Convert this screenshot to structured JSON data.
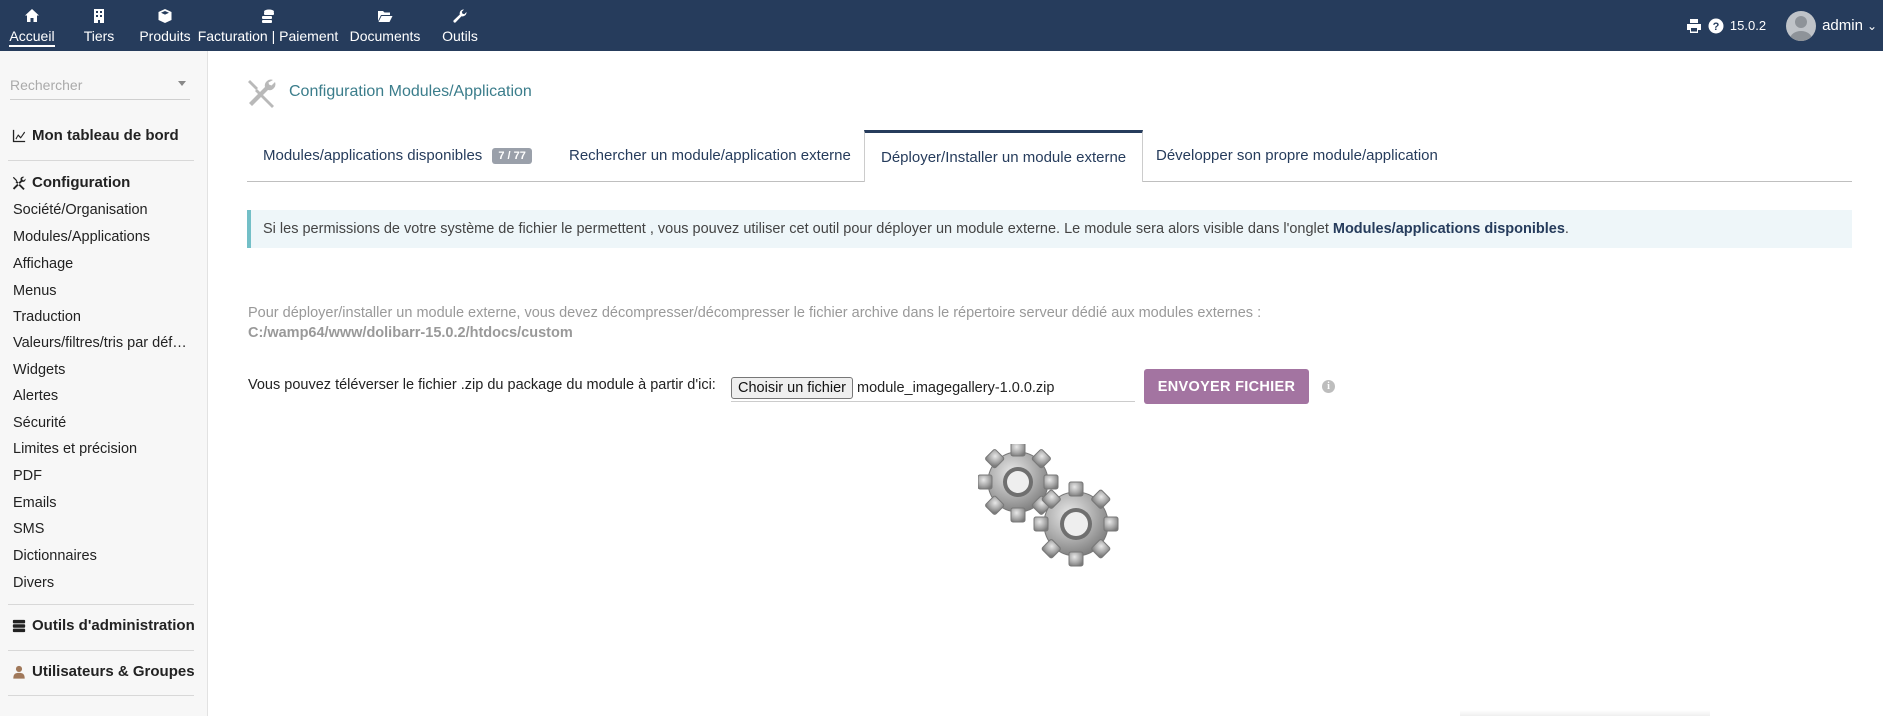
{
  "topmenu": {
    "items": [
      {
        "label": "Accueil",
        "icon": "home-icon"
      },
      {
        "label": "Tiers",
        "icon": "building-icon"
      },
      {
        "label": "Produits",
        "icon": "cube-icon"
      },
      {
        "label": "Facturation | Paiement",
        "icon": "coins-icon"
      },
      {
        "label": "Documents",
        "icon": "folder-open-icon"
      },
      {
        "label": "Outils",
        "icon": "wrench-icon"
      }
    ],
    "version": "15.0.2",
    "username": "admin"
  },
  "sidebar": {
    "search_placeholder": "Rechercher",
    "dashboard_label": "Mon tableau de bord",
    "config_label": "Configuration",
    "config_items": [
      "Société/Organisation",
      "Modules/Applications",
      "Affichage",
      "Menus",
      "Traduction",
      "Valeurs/filtres/tris par déf…",
      "Widgets",
      "Alertes",
      "Sécurité",
      "Limites et précision",
      "PDF",
      "Emails",
      "SMS",
      "Dictionnaires",
      "Divers"
    ],
    "admin_tools_label": "Outils d'administration",
    "users_label": "Utilisateurs & Groupes"
  },
  "main": {
    "title": "Configuration Modules/Application",
    "tabs": [
      {
        "label": "Modules/applications disponibles",
        "badge": "7 / 77"
      },
      {
        "label": "Rechercher un module/application externe"
      },
      {
        "label": "Déployer/Installer un module externe"
      },
      {
        "label": "Développer son propre module/application"
      }
    ],
    "active_tab": "Déployer/Installer un module externe",
    "info_text": "Si les permissions de votre système de fichier le permettent , vous pouvez utiliser cet outil pour déployer un module externe. Le module sera alors visible dans l'onglet ",
    "info_bold": "Modules/applications disponibles",
    "info_end": ".",
    "desc_line1": "Pour déployer/installer un module externe, vous devez décompresser/décompresser le fichier archive dans le répertoire serveur dédié aux modules externes :",
    "desc_path": "C:/wamp64/www/dolibarr-15.0.2/htdocs/custom",
    "upload_label": "Vous pouvez téléverser le fichier .zip du package du module à partir d'ici:",
    "choose_file_label": "Choisir un fichier",
    "file_name": "module_imagegallery-1.0.0.zip",
    "send_label": "ENVOYER FICHIER"
  },
  "colors": {
    "topbar": "#263c5c",
    "accent_link": "#3b7d8b",
    "send_button": "#a374a1",
    "info_border": "#73bfc7",
    "info_bg": "#eef6f9"
  }
}
